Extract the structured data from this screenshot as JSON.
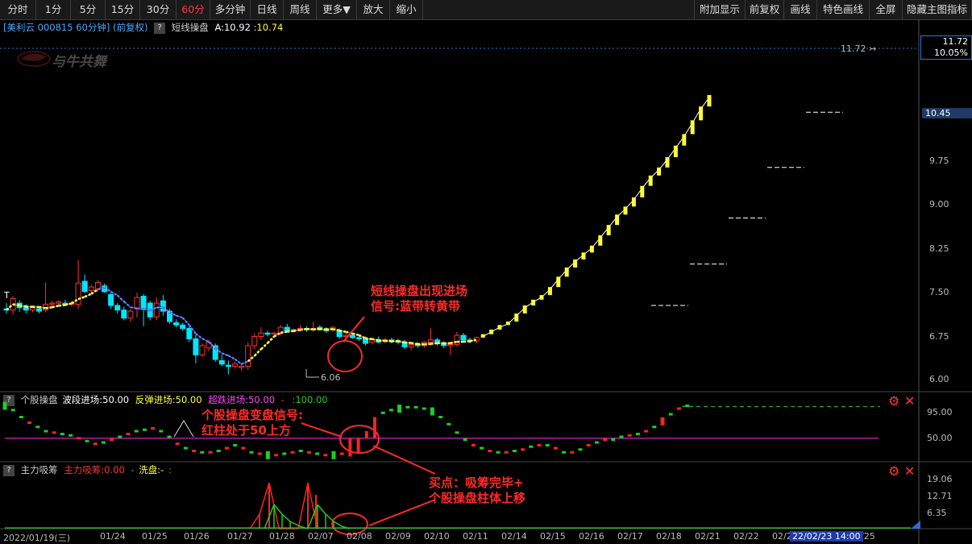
{
  "toolbar": {
    "left": [
      "分时",
      "1分",
      "5分",
      "15分",
      "30分",
      "60分",
      "多分钟",
      "日线",
      "周线",
      "更多▼",
      "放大",
      "缩小"
    ],
    "active": "60分",
    "right": [
      "附加显示",
      "前复权",
      "画线",
      "特色画线",
      "全屏",
      "隐藏主图指标"
    ]
  },
  "info": {
    "stock": "[美利云 000815 60分钟]",
    "adjust": "(前复权)",
    "q": "?",
    "indicator": "短线操盘",
    "a_label": "A:10.92",
    "b_label": ":10.74"
  },
  "watermark": "与牛共舞",
  "price_axis": {
    "ticks": [
      "10.45",
      "9.75",
      "9.00",
      "8.25",
      "7.50",
      "6.75",
      "6.00"
    ],
    "top_price": "11.72",
    "top_pct": "10.05%",
    "high_mark": "11.72",
    "low_mark": "6.06",
    "t_marker": "T"
  },
  "panel2": {
    "q": "?",
    "name": "个股操盘",
    "wave": "波段进场:50.00",
    "rebound": "反弹进场:50.00",
    "oversold": "超跌进场:50.00",
    "dash": "-",
    "hundred": ":100.00",
    "ticks": [
      "95.00",
      "50.00"
    ]
  },
  "panel3": {
    "q": "?",
    "name": "主力吸筹",
    "main": "主力吸筹:0.00",
    "dash": "-",
    "wash": "洗盘:-",
    "colon": ":",
    "ticks": [
      "19.06",
      "12.71",
      "6.35"
    ]
  },
  "dates": [
    "2022/01/19(三)",
    "01/24",
    "01/25",
    "01/26",
    "01/27",
    "01/28",
    "02/07",
    "02/08",
    "02/09",
    "02/10",
    "02/11",
    "02/14",
    "02/15",
    "02/16",
    "02/17",
    "02/18",
    "02/21",
    "02/22",
    "02/23",
    "02/25"
  ],
  "cursor_date": "22/02/23 14:00",
  "annotations": {
    "a1_line1": "短线操盘出现进场",
    "a1_line2": "信号:蓝带转黄带",
    "a2_line1": "个股操盘变盘信号:",
    "a2_line2": "红柱处于50上方",
    "a3_line1": "买点：吸筹完毕+",
    "a3_line2": "个股操盘柱体上移"
  },
  "colors": {
    "up": "#ff3232",
    "down": "#00e5ff",
    "yellow_band": "#ffff33",
    "blue_band": "#3355ff",
    "panel2_line": "#cc22cc",
    "green": "#22cc22",
    "red": "#ff2222"
  },
  "chart_data": {
    "type": "candlestick",
    "interval": "60分钟",
    "ylim": [
      5.9,
      11.9
    ],
    "candles": [
      {
        "o": 7.2,
        "h": 7.3,
        "l": 7.12,
        "c": 7.18
      },
      {
        "o": 7.18,
        "h": 7.42,
        "l": 7.1,
        "c": 7.38
      },
      {
        "o": 7.3,
        "h": 7.35,
        "l": 7.15,
        "c": 7.22
      },
      {
        "o": 7.22,
        "h": 7.28,
        "l": 7.12,
        "c": 7.18
      },
      {
        "o": 7.18,
        "h": 7.26,
        "l": 7.14,
        "c": 7.22
      },
      {
        "o": 7.2,
        "h": 7.24,
        "l": 7.12,
        "c": 7.16
      },
      {
        "o": 7.18,
        "h": 7.66,
        "l": 7.14,
        "c": 7.28
      },
      {
        "o": 7.28,
        "h": 7.34,
        "l": 7.22,
        "c": 7.3
      },
      {
        "o": 7.3,
        "h": 7.35,
        "l": 7.25,
        "c": 7.32
      },
      {
        "o": 7.3,
        "h": 7.36,
        "l": 7.25,
        "c": 7.28
      },
      {
        "o": 7.28,
        "h": 7.34,
        "l": 7.24,
        "c": 7.3
      },
      {
        "o": 7.28,
        "h": 8.05,
        "l": 7.2,
        "c": 7.65
      },
      {
        "o": 7.68,
        "h": 7.8,
        "l": 7.48,
        "c": 7.5
      },
      {
        "o": 7.52,
        "h": 7.62,
        "l": 7.44,
        "c": 7.58
      },
      {
        "o": 7.55,
        "h": 7.7,
        "l": 7.5,
        "c": 7.66
      },
      {
        "o": 7.6,
        "h": 7.64,
        "l": 7.48,
        "c": 7.5
      },
      {
        "o": 7.45,
        "h": 7.5,
        "l": 7.2,
        "c": 7.26
      },
      {
        "o": 7.26,
        "h": 7.3,
        "l": 7.12,
        "c": 7.18
      },
      {
        "o": 7.18,
        "h": 7.24,
        "l": 7.0,
        "c": 7.04
      },
      {
        "o": 7.04,
        "h": 7.2,
        "l": 6.98,
        "c": 7.16
      },
      {
        "o": 7.2,
        "h": 7.48,
        "l": 7.05,
        "c": 7.4
      },
      {
        "o": 7.42,
        "h": 7.46,
        "l": 6.9,
        "c": 7.2
      },
      {
        "o": 7.3,
        "h": 7.34,
        "l": 7.0,
        "c": 7.06
      },
      {
        "o": 7.06,
        "h": 7.4,
        "l": 7.0,
        "c": 7.3
      },
      {
        "o": 7.34,
        "h": 7.44,
        "l": 7.08,
        "c": 7.16
      },
      {
        "o": 7.16,
        "h": 7.2,
        "l": 6.94,
        "c": 6.98
      },
      {
        "o": 6.96,
        "h": 7.02,
        "l": 6.88,
        "c": 6.92
      },
      {
        "o": 6.92,
        "h": 6.96,
        "l": 6.82,
        "c": 6.86
      },
      {
        "o": 6.86,
        "h": 6.9,
        "l": 6.62,
        "c": 6.68
      },
      {
        "o": 6.68,
        "h": 6.75,
        "l": 6.25,
        "c": 6.4
      },
      {
        "o": 6.4,
        "h": 6.6,
        "l": 6.36,
        "c": 6.56
      },
      {
        "o": 6.52,
        "h": 6.66,
        "l": 6.46,
        "c": 6.62
      },
      {
        "o": 6.56,
        "h": 6.6,
        "l": 6.28,
        "c": 6.32
      },
      {
        "o": 6.3,
        "h": 6.4,
        "l": 6.2,
        "c": 6.24
      },
      {
        "o": 6.22,
        "h": 6.3,
        "l": 6.06,
        "c": 6.2
      },
      {
        "o": 6.2,
        "h": 6.28,
        "l": 6.16,
        "c": 6.24
      },
      {
        "o": 6.18,
        "h": 6.24,
        "l": 6.12,
        "c": 6.2
      },
      {
        "o": 6.2,
        "h": 6.62,
        "l": 6.14,
        "c": 6.56
      },
      {
        "o": 6.56,
        "h": 6.78,
        "l": 6.5,
        "c": 6.72
      },
      {
        "o": 6.72,
        "h": 6.88,
        "l": 6.66,
        "c": 6.78
      },
      {
        "o": 6.78,
        "h": 6.82,
        "l": 6.72,
        "c": 6.76
      },
      {
        "o": 6.76,
        "h": 6.8,
        "l": 6.7,
        "c": 6.78
      },
      {
        "o": 6.78,
        "h": 6.92,
        "l": 6.74,
        "c": 6.88
      },
      {
        "o": 6.88,
        "h": 6.94,
        "l": 6.8,
        "c": 6.82
      },
      {
        "o": 6.82,
        "h": 6.86,
        "l": 6.78,
        "c": 6.84
      },
      {
        "o": 6.84,
        "h": 6.92,
        "l": 6.8,
        "c": 6.86
      },
      {
        "o": 6.86,
        "h": 6.9,
        "l": 6.8,
        "c": 6.84
      },
      {
        "o": 6.84,
        "h": 6.98,
        "l": 6.8,
        "c": 6.86
      },
      {
        "o": 6.88,
        "h": 6.92,
        "l": 6.82,
        "c": 6.84
      },
      {
        "o": 6.84,
        "h": 6.88,
        "l": 6.78,
        "c": 6.82
      },
      {
        "o": 6.84,
        "h": 6.9,
        "l": 6.8,
        "c": 6.88
      },
      {
        "o": 6.82,
        "h": 6.86,
        "l": 6.68,
        "c": 6.72
      },
      {
        "o": 6.72,
        "h": 6.78,
        "l": 6.66,
        "c": 6.74
      },
      {
        "o": 6.74,
        "h": 6.78,
        "l": 6.68,
        "c": 6.7
      },
      {
        "o": 6.7,
        "h": 6.74,
        "l": 6.64,
        "c": 6.68
      },
      {
        "o": 6.68,
        "h": 6.72,
        "l": 6.56,
        "c": 6.6
      },
      {
        "o": 6.62,
        "h": 6.68,
        "l": 6.58,
        "c": 6.66
      },
      {
        "o": 6.66,
        "h": 6.72,
        "l": 6.6,
        "c": 6.62
      },
      {
        "o": 6.64,
        "h": 6.7,
        "l": 6.6,
        "c": 6.66
      },
      {
        "o": 6.66,
        "h": 6.7,
        "l": 6.6,
        "c": 6.64
      },
      {
        "o": 6.64,
        "h": 6.68,
        "l": 6.58,
        "c": 6.62
      },
      {
        "o": 6.62,
        "h": 6.66,
        "l": 6.5,
        "c": 6.54
      },
      {
        "o": 6.54,
        "h": 6.6,
        "l": 6.48,
        "c": 6.58
      },
      {
        "o": 6.58,
        "h": 6.62,
        "l": 6.52,
        "c": 6.56
      },
      {
        "o": 6.56,
        "h": 6.64,
        "l": 6.52,
        "c": 6.62
      },
      {
        "o": 6.62,
        "h": 6.86,
        "l": 6.56,
        "c": 6.66
      },
      {
        "o": 6.66,
        "h": 6.7,
        "l": 6.56,
        "c": 6.6
      },
      {
        "o": 6.6,
        "h": 6.64,
        "l": 6.52,
        "c": 6.56
      },
      {
        "o": 6.56,
        "h": 6.62,
        "l": 6.4,
        "c": 6.58
      },
      {
        "o": 6.58,
        "h": 6.8,
        "l": 6.54,
        "c": 6.74
      },
      {
        "o": 6.74,
        "h": 6.78,
        "l": 6.62,
        "c": 6.66
      },
      {
        "o": 6.66,
        "h": 6.7,
        "l": 6.6,
        "c": 6.64
      },
      {
        "o": 6.64,
        "h": 6.72,
        "l": 6.6,
        "c": 6.7
      }
    ],
    "surge_closes": [
      6.76,
      6.84,
      6.92,
      6.98,
      7.12,
      7.26,
      7.36,
      7.44,
      7.58,
      7.76,
      7.92,
      8.06,
      8.18,
      8.3,
      8.48,
      8.66,
      8.84,
      8.98,
      9.14,
      9.34,
      9.52,
      9.66,
      9.84,
      10.04,
      10.24,
      10.48,
      10.72,
      10.92
    ],
    "limit_dashes": [
      7.26,
      7.98,
      8.78,
      9.66,
      10.62
    ],
    "panel2_levels": [
      50,
      95
    ]
  }
}
